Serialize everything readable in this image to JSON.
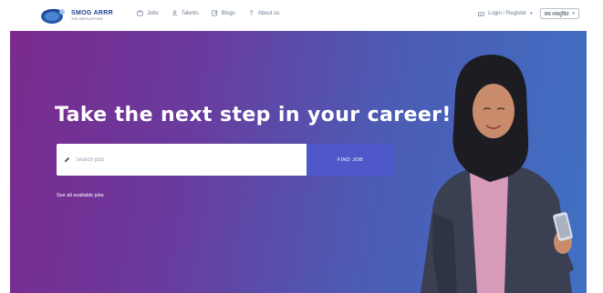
{
  "brand": {
    "name": "SMOG ARRR",
    "tagline": "THE JOB PLATFORM"
  },
  "nav": {
    "items": [
      {
        "label": "Jobs",
        "icon": "briefcase-icon"
      },
      {
        "label": "Talents",
        "icon": "user-icon"
      },
      {
        "label": "Blogs",
        "icon": "edit-icon"
      },
      {
        "label": "About us",
        "icon": "question-icon"
      }
    ],
    "login_label": "Login / Register",
    "language_selected": "छब सबसुबित"
  },
  "hero": {
    "title": "Take the next step in your career!",
    "search_placeholder": "Search jobs",
    "search_button": "FIND JOB",
    "see_all_link": "See all available jobs"
  },
  "colors": {
    "gradient_start": "#7a2a8e",
    "gradient_end": "#3f70c3",
    "button": "#4e58c8",
    "brand_blue": "#1d3f8f"
  }
}
